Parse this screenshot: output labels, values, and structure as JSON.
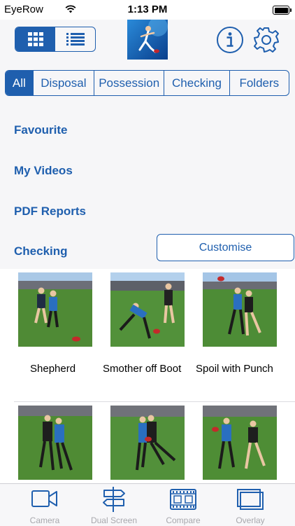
{
  "status_bar": {
    "carrier": "EyeRow",
    "time": "1:13 PM"
  },
  "header": {
    "view_toggle": [
      "grid",
      "list"
    ],
    "active_view": "grid"
  },
  "filter_tabs": [
    {
      "label": "All",
      "active": true
    },
    {
      "label": "Disposal",
      "active": false
    },
    {
      "label": "Possession",
      "active": false
    },
    {
      "label": "Checking",
      "active": false
    },
    {
      "label": "Folders",
      "active": false
    }
  ],
  "menu": {
    "favourite": "Favourite",
    "my_videos": "My Videos",
    "pdf_reports": "PDF Reports",
    "section_title": "Checking",
    "customise": "Customise"
  },
  "videos": [
    {
      "caption": "Shepherd"
    },
    {
      "caption": "Smother off Boot"
    },
    {
      "caption": "Spoil with Punch"
    },
    {
      "caption": ""
    },
    {
      "caption": ""
    },
    {
      "caption": ""
    }
  ],
  "tab_bar": [
    {
      "label": "Camera",
      "icon": "video-camera-icon"
    },
    {
      "label": "Dual Screen",
      "icon": "signpost-icon"
    },
    {
      "label": "Compare",
      "icon": "film-strip-icon"
    },
    {
      "label": "Overlay",
      "icon": "overlay-icon"
    }
  ],
  "colors": {
    "accent": "#1f5fae",
    "background": "#f6f6f8",
    "inactive_tab": "#a8a8ad"
  }
}
